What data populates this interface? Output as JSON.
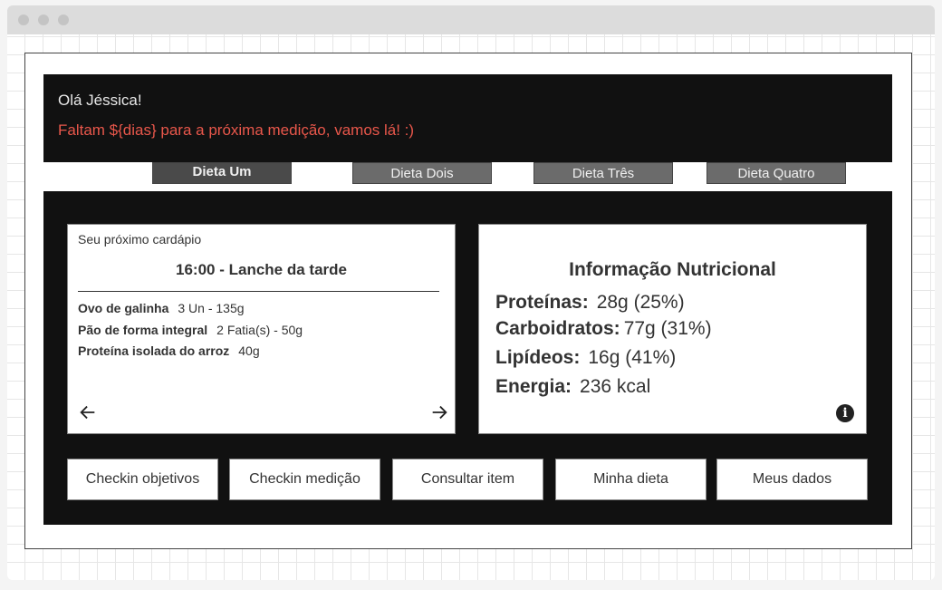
{
  "header": {
    "greeting": "Olá Jéssica!",
    "countdown": "Faltam ${dias} para a próxima medição, vamos lá! :)"
  },
  "tabs": [
    {
      "label": "Dieta Um",
      "active": true
    },
    {
      "label": "Dieta Dois",
      "active": false
    },
    {
      "label": "Dieta Três",
      "active": false
    },
    {
      "label": "Dieta Quatro",
      "active": false
    }
  ],
  "menu_card": {
    "caption": "Seu próximo cardápio",
    "meal_title": "16:00 - Lanche da tarde",
    "items": [
      {
        "name": "Ovo de galinha",
        "qty": "3 Un - 135g"
      },
      {
        "name": "Pão de forma integral",
        "qty": "2 Fatia(s) - 50g"
      },
      {
        "name": "Proteína isolada do arroz",
        "qty": "40g"
      }
    ],
    "prev_icon": "arrow-left-icon",
    "next_icon": "arrow-right-icon"
  },
  "info_card": {
    "title": "Informação Nutricional",
    "rows": [
      {
        "label": "Proteínas:",
        "value": "28g (25%)"
      },
      {
        "label": "Carboidratos:",
        "value": "77g (31%)"
      },
      {
        "label": "Lipídeos:",
        "value": "16g (41%)"
      },
      {
        "label": "Energia:",
        "value": "236 kcal"
      }
    ],
    "info_glyph": "i",
    "info_icon": "info-icon"
  },
  "actions": [
    {
      "label": "Checkin objetivos"
    },
    {
      "label": "Checkin medição"
    },
    {
      "label": "Consultar item"
    },
    {
      "label": "Minha dieta"
    },
    {
      "label": "Meus dados"
    }
  ],
  "colors": {
    "background_dark": "#111111",
    "accent_red": "#e9574b",
    "tab_bg": "#6b6b6b",
    "tab_active_bg": "#4a4a4a"
  }
}
